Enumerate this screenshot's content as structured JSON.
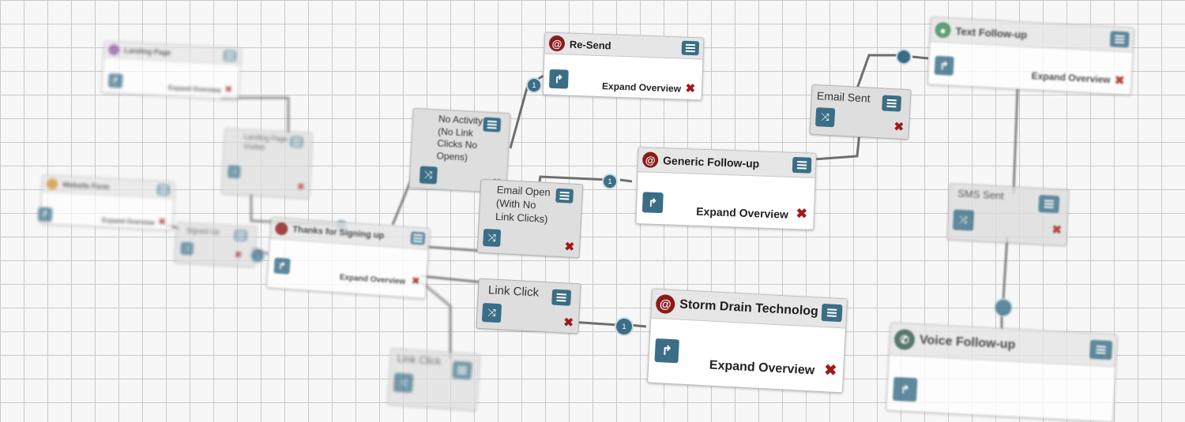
{
  "nodes": {
    "landing_page": {
      "title": "Landing Page",
      "expand": "Expand Overview",
      "close": "✖"
    },
    "website_form": {
      "title": "Website Form",
      "expand": "Expand Overview",
      "close": "✖"
    },
    "thanks": {
      "title": "Thanks for Signing up",
      "expand": "Expand Overview",
      "close": "✖"
    },
    "resend": {
      "title": "Re-Send",
      "expand": "Expand Overview",
      "close": "✖"
    },
    "generic_followup": {
      "title": "Generic Follow-up",
      "expand": "Expand Overview",
      "close": "✖"
    },
    "storm_drain": {
      "title": "Storm Drain Technolog",
      "expand": "Expand Overview",
      "close": "✖"
    },
    "text_followup": {
      "title": "Text Follow-up",
      "expand": "Expand Overview",
      "close": "✖"
    },
    "voice_followup": {
      "title": "Voice Follow-up"
    }
  },
  "conditions": {
    "landing_page_visited": {
      "label": "Landing Page Visited",
      "close": "✖"
    },
    "signed_up": {
      "label": "Signed Up",
      "close": "✖"
    },
    "no_activity": {
      "label": "No Activity (No Link Clicks No Opens)",
      "close": "✖"
    },
    "email_open": {
      "label": "Email Open (With No Link Clicks)",
      "close": "✖"
    },
    "link_click": {
      "label": "Link Click",
      "close": "✖"
    },
    "link_click_2": {
      "label": "Link Click"
    },
    "email_sent": {
      "label": "Email Sent",
      "close": "✖"
    },
    "sms_sent": {
      "label": "SMS Sent",
      "close": "✖"
    }
  },
  "icons": {
    "email_badge": "@",
    "connector": "1"
  },
  "colors": {
    "accent": "#3a6e86",
    "email_badge": "#8b1a1a",
    "text_badge": "#3c8a5a",
    "voice_badge": "#2f5a4a",
    "form_badge": "#c98a1a",
    "landing_badge": "#8a4c9a",
    "close": "#a01818"
  }
}
